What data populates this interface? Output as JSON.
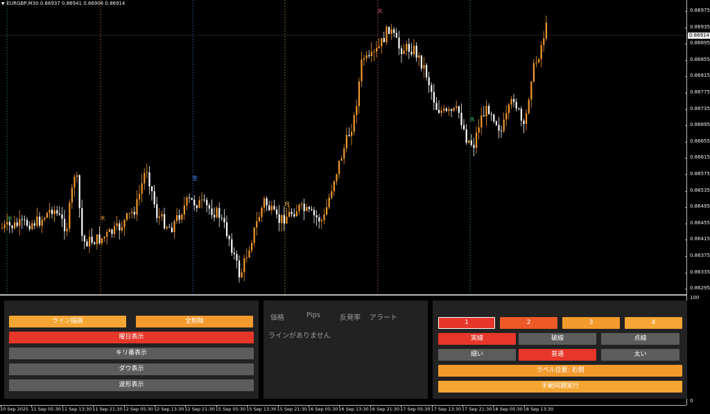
{
  "chart": {
    "title": "EURGBP,M30  0.86937 0.86941 0.86906 0.86914",
    "current_price": "0.86914",
    "price_labels": [
      "0.86975",
      "0.86935",
      "0.86895",
      "0.86855",
      "0.86815",
      "0.86775",
      "0.86735",
      "0.86695",
      "0.86655",
      "0.86615",
      "0.86575",
      "0.86535",
      "0.86495",
      "0.86455",
      "0.86415",
      "0.86375",
      "0.86335",
      "0.86295"
    ],
    "sub_labels": [
      "100",
      "0"
    ],
    "time_labels": [
      "10 Sep 2025",
      "11 Sep 05:30",
      "11 Sep 13:30",
      "11 Sep 21:30",
      "12 Sep 05:30",
      "12 Sep 13:30",
      "12 Sep 21:30",
      "15 Sep 05:30",
      "15 Sep 13:30",
      "15 Sep 21:30",
      "16 Sep 05:30",
      "16 Sep 13:30",
      "16 Sep 21:30",
      "17 Sep 05:30",
      "17 Sep 13:30",
      "17 Sep 21:30",
      "18 Sep 05:30",
      "18 Sep 13:30"
    ],
    "day_markers": [
      {
        "label": "水",
        "color": "#3fbf6f"
      },
      {
        "label": "木",
        "color": "#f39a2d"
      },
      {
        "label": "金",
        "color": "#4a8fff"
      },
      {
        "label": "月",
        "color": "#f5c542"
      },
      {
        "label": "火",
        "color": "#ff5fa0"
      },
      {
        "label": "水",
        "color": "#3fbf6f"
      }
    ],
    "colors": {
      "bull": "#f39a2d",
      "bear": "#ffffff",
      "background": "#000000"
    }
  },
  "left_panel": {
    "draw_lines": "ライン描画",
    "delete_all": "全削除",
    "weekday_display": "曜日表示",
    "round_number_display": "キリ番表示",
    "dow_display": "ダウ表示",
    "wave_display": "波形表示"
  },
  "mid_panel": {
    "col_price": "価格",
    "col_pips": "Pips",
    "col_rebound": "反発率",
    "col_alert": "アラート",
    "empty_message": "ラインがありません"
  },
  "right_panel": {
    "slots": [
      "1",
      "2",
      "3",
      "4"
    ],
    "style_solid": "実線",
    "style_dashed": "破線",
    "style_dotted": "点線",
    "width_thin": "細い",
    "width_normal": "普通",
    "width_thick": "太い",
    "label_position": "ラベル位置: 右側",
    "manual_sync": "手動同期実行"
  }
}
